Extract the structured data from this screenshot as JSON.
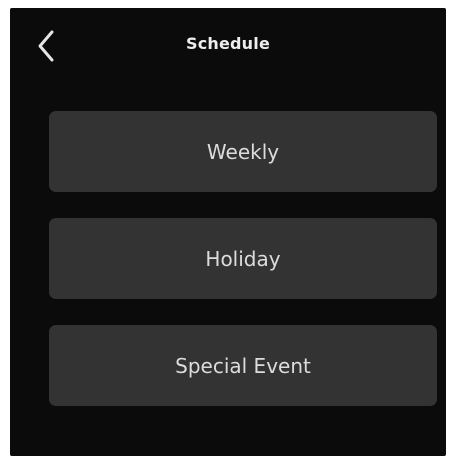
{
  "header": {
    "back_icon": "chevron-left-icon",
    "title": "Schedule"
  },
  "menu": {
    "items": [
      {
        "label": "Weekly"
      },
      {
        "label": "Holiday"
      },
      {
        "label": "Special Event"
      }
    ]
  },
  "colors": {
    "background": "#0b0b0b",
    "button": "#333333",
    "text": "#dcdcdc"
  }
}
